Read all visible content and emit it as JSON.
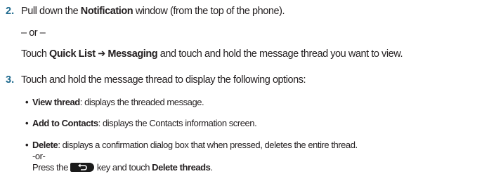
{
  "steps": [
    {
      "number": "2.",
      "line1": {
        "pre": "Pull down the ",
        "bold": "Notification",
        "post": " window (from the top of the phone)."
      },
      "or_text": "– or –",
      "line2": {
        "pre": "Touch ",
        "bold1": "Quick List",
        "arrow": "➔",
        "bold2": "Messaging",
        "post": " and touch and hold the message thread you want to view."
      }
    },
    {
      "number": "3.",
      "line1": {
        "text": "Touch and hold the message thread to display the following options:"
      },
      "bullets": [
        {
          "symbol": "•",
          "bold": "View thread",
          "text": ": displays the threaded message."
        },
        {
          "symbol": "•",
          "bold": "Add to Contacts",
          "text": ": displays the Contacts information screen."
        },
        {
          "symbol": "•",
          "bold": "Delete",
          "text": ": displays a confirmation dialog box that when pressed, deletes the entire thread."
        }
      ],
      "alt_or": "-or-",
      "press": {
        "pre": "Press the",
        "key_icon": "back-key-icon",
        "mid": "key and touch ",
        "bold": "Delete threads",
        "post": "."
      }
    }
  ],
  "colors": {
    "step_number": "#1f6a8e",
    "text": "#231f20",
    "key_icon_bg": "#1a1a1a"
  }
}
